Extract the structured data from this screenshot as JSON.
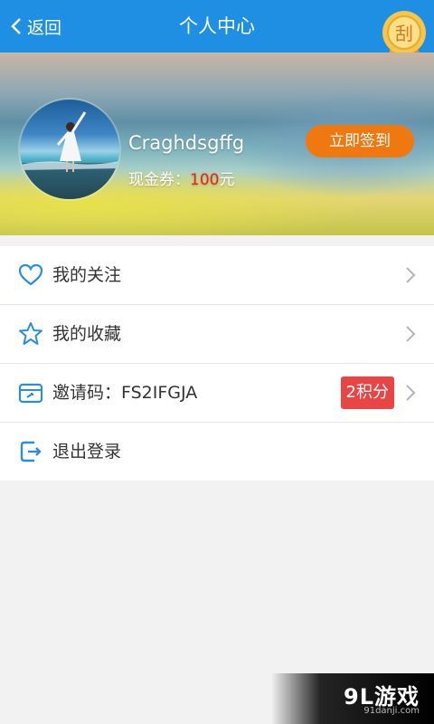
{
  "header": {
    "back_label": "返回",
    "title": "个人中心",
    "badge_char": "刮"
  },
  "profile": {
    "username": "Craghdsgffg",
    "coupon_label": "现金券：",
    "coupon_amount": "100",
    "coupon_unit": "元",
    "checkin_label": "立即签到"
  },
  "menu": {
    "items": [
      {
        "label": "我的关注",
        "icon": "heart-icon"
      },
      {
        "label": "我的收藏",
        "icon": "star-icon"
      },
      {
        "label": "邀请码：FS2IFGJA",
        "icon": "invite-card-icon",
        "badge": "2积分"
      },
      {
        "label": "退出登录",
        "icon": "logout-icon"
      }
    ]
  },
  "watermark": {
    "logo": "9L游戏",
    "url": "91danji.com"
  },
  "colors": {
    "header_bg": "#1e8fe3",
    "checkin_bg": "#f07810",
    "amount": "#e8231f",
    "points_badge": "#e84545",
    "icon_blue": "#2a8ee0"
  }
}
